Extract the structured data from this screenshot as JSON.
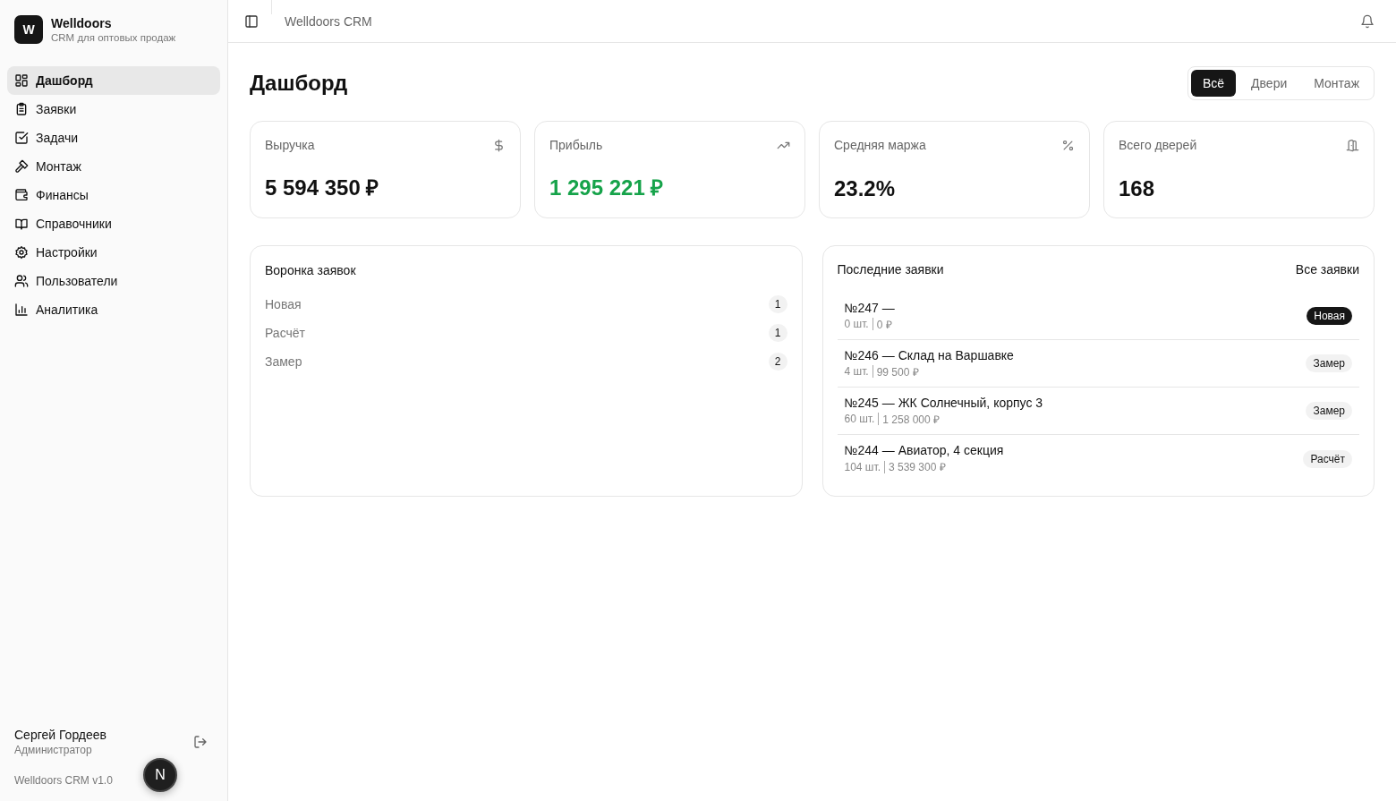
{
  "brand": {
    "logo": "W",
    "name": "Welldoors",
    "subtitle": "CRM для оптовых продаж"
  },
  "nav": [
    {
      "label": "Дашборд",
      "kind": "grid",
      "selected": true
    },
    {
      "label": "Заявки",
      "kind": "clipboard",
      "selected": false
    },
    {
      "label": "Задачи",
      "kind": "check",
      "selected": false
    },
    {
      "label": "Монтаж",
      "kind": "hammer",
      "selected": false
    },
    {
      "label": "Финансы",
      "kind": "wallet",
      "selected": false
    },
    {
      "label": "Справочники",
      "kind": "book",
      "selected": false
    },
    {
      "label": "Настройки",
      "kind": "gear",
      "selected": false
    },
    {
      "label": "Пользователи",
      "kind": "users",
      "selected": false
    },
    {
      "label": "Аналитика",
      "kind": "chart",
      "selected": false
    }
  ],
  "user": {
    "name": "Сергей Гордеев",
    "role": "Администратор"
  },
  "version": "Welldoors CRM v1.0",
  "dev_badge": "N",
  "header": {
    "title": "Welldoors CRM"
  },
  "page_title": "Дашборд",
  "filter_tabs": [
    {
      "label": "Всё",
      "selected": true
    },
    {
      "label": "Двери",
      "selected": false
    },
    {
      "label": "Монтаж",
      "selected": false
    }
  ],
  "stats": [
    {
      "label": "Выручка",
      "value": "5 594 350 ₽",
      "kind": "dollar",
      "positive": false
    },
    {
      "label": "Прибыль",
      "value": "1 295 221 ₽",
      "kind": "trend",
      "positive": true
    },
    {
      "label": "Средняя маржа",
      "value": "23.2%",
      "kind": "percent",
      "positive": false
    },
    {
      "label": "Всего дверей",
      "value": "168",
      "kind": "door",
      "positive": false
    }
  ],
  "funnel": {
    "title": "Воронка заявок",
    "rows": [
      {
        "label": "Новая",
        "count": "1"
      },
      {
        "label": "Расчёт",
        "count": "1"
      },
      {
        "label": "Замер",
        "count": "2"
      }
    ]
  },
  "recent": {
    "title": "Последние заявки",
    "link": "Все заявки",
    "rows": [
      {
        "title": "№247 —",
        "qty": "0 шт.",
        "sum": "0 ₽",
        "status": "Новая",
        "kind": "filled"
      },
      {
        "title": "№246 — Склад на Варшавке",
        "qty": "4 шт.",
        "sum": "99 500 ₽",
        "status": "Замер",
        "kind": "soft"
      },
      {
        "title": "№245 — ЖК Солнечный, корпус 3",
        "qty": "60 шт.",
        "sum": "1 258 000 ₽",
        "status": "Замер",
        "kind": "soft"
      },
      {
        "title": "№244 — Авиатор, 4 секция",
        "qty": "104 шт.",
        "sum": "3 539 300 ₽",
        "status": "Расчёт",
        "kind": "soft"
      }
    ]
  }
}
